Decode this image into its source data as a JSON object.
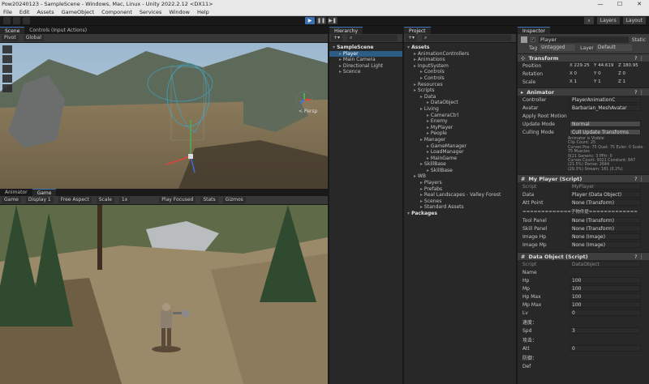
{
  "window": {
    "title": "Pow20240123 - SampleScene - Windows, Mac, Linux - Unity 2022.2.12 <DX11>",
    "minimize": "—",
    "maximize": "☐",
    "close": "✕"
  },
  "menu": [
    "File",
    "Edit",
    "Assets",
    "GameObject",
    "Component",
    "Services",
    "Window",
    "Help"
  ],
  "toolbar": {
    "play": "▶",
    "pause": "❚❚",
    "step": "▶❚",
    "layers": "Layers",
    "layout": "Layout"
  },
  "scene": {
    "tabs": [
      "Scene",
      "Controls (Input Actions)"
    ],
    "pivot": "Pivot",
    "global": "Global",
    "persp": "< Persp"
  },
  "game": {
    "tabs": [
      "Animator",
      "Game"
    ],
    "game_label": "Game",
    "display": "Display 1",
    "aspect": "Free Aspect",
    "scale_label": "Scale",
    "scale_value": "1x",
    "play_focused": "Play Focused",
    "stats": "Stats",
    "gizmos": "Gizmos"
  },
  "hierarchy": {
    "tab": "Hierarchy",
    "items": [
      {
        "label": "SampleScene",
        "depth": 0,
        "style": "bold"
      },
      {
        "label": "Player",
        "depth": 1,
        "style": "sel"
      },
      {
        "label": "Main Camera",
        "depth": 1,
        "style": ""
      },
      {
        "label": "Directional Light",
        "depth": 1,
        "style": ""
      },
      {
        "label": "Scence",
        "depth": 1,
        "style": ""
      }
    ]
  },
  "project": {
    "tab": "Project",
    "items": [
      {
        "label": "Assets",
        "depth": 0,
        "style": "bold"
      },
      {
        "label": "AnimationControllers",
        "depth": 1,
        "style": ""
      },
      {
        "label": "Animations",
        "depth": 1,
        "style": ""
      },
      {
        "label": "InputSystem",
        "depth": 1,
        "style": ""
      },
      {
        "label": "Controls",
        "depth": 2,
        "style": ""
      },
      {
        "label": "Controls",
        "depth": 2,
        "style": ""
      },
      {
        "label": "Resources",
        "depth": 1,
        "style": ""
      },
      {
        "label": "Scripts",
        "depth": 1,
        "style": ""
      },
      {
        "label": "Data",
        "depth": 2,
        "style": ""
      },
      {
        "label": "DataObject",
        "depth": 3,
        "style": ""
      },
      {
        "label": "Living",
        "depth": 2,
        "style": ""
      },
      {
        "label": "CameraCtrl",
        "depth": 3,
        "style": ""
      },
      {
        "label": "Enemy",
        "depth": 3,
        "style": ""
      },
      {
        "label": "MyPlayer",
        "depth": 3,
        "style": ""
      },
      {
        "label": "People",
        "depth": 3,
        "style": ""
      },
      {
        "label": "Manager",
        "depth": 2,
        "style": ""
      },
      {
        "label": "GameManager",
        "depth": 3,
        "style": ""
      },
      {
        "label": "LoadManager",
        "depth": 3,
        "style": ""
      },
      {
        "label": "MainGame",
        "depth": 3,
        "style": ""
      },
      {
        "label": "SkillBase",
        "depth": 2,
        "style": ""
      },
      {
        "label": "SkillBase",
        "depth": 3,
        "style": ""
      },
      {
        "label": "WB",
        "depth": 1,
        "style": ""
      },
      {
        "label": "Players",
        "depth": 2,
        "style": ""
      },
      {
        "label": "Prefabs",
        "depth": 2,
        "style": ""
      },
      {
        "label": "Real Landscapes - Valley Forest",
        "depth": 2,
        "style": ""
      },
      {
        "label": "Scenes",
        "depth": 2,
        "style": ""
      },
      {
        "label": "Standard Assets",
        "depth": 2,
        "style": ""
      },
      {
        "label": "Packages",
        "depth": 0,
        "style": "bold"
      }
    ]
  },
  "inspector": {
    "tab": "Inspector",
    "object_name": "Player",
    "static_label": "Static",
    "tag_label": "Tag",
    "tag_value": "Untagged",
    "layer_label": "Layer",
    "layer_value": "Default",
    "transform": {
      "title": "Transform",
      "position_label": "Position",
      "rotation_label": "Rotation",
      "scale_label": "Scale",
      "position": [
        "X 229.25",
        "Y 44.619",
        "Z 180.95"
      ],
      "rotation": [
        "X 0",
        "Y 0",
        "Z 0"
      ],
      "scale": [
        "X 1",
        "Y 1",
        "Z 1"
      ]
    },
    "animator": {
      "title": "Animator",
      "controller_label": "Controller",
      "controller_value": "PlayerAnimationC",
      "avatar_label": "Avatar",
      "avatar_value": "Barbarian_MeshAvatar",
      "root_motion_label": "Apply Root Motion",
      "update_label": "Update Mode",
      "update_value": "Normal",
      "culling_label": "Culling Mode",
      "culling_value": "Cull Update Transforms",
      "notes": [
        "Animator is Visible",
        "Clip Count: 25",
        "Curves Pos: 75 Quat: 75 Euler: 0 Scale: 75 Muscles",
        "0(21 Generic: 3 PPtr: 0",
        "Curves Count: 9021 Constant: 847 (21.5%) Dense: 2644",
        "(29.3%) Stream: 181 (0.2%)"
      ]
    },
    "myplayer": {
      "title": "My Player (Script)",
      "script_label": "Script",
      "script_value": "MyPlayer",
      "data_label": "Data",
      "data_value": "Player (Data Object)",
      "att_label": "Att Point",
      "att_value": "None (Transform)",
      "divider": "=============子物件提=============",
      "tool_label": "Tool Panel",
      "tool_value": "None (Transform)",
      "skill_label": "Skill Panel",
      "skill_value": "None (Transform)",
      "hp_img_label": "Image Hp",
      "hp_img_value": "None (Image)",
      "mp_img_label": "Image Mp",
      "mp_img_value": "None (Image)"
    },
    "dataobject": {
      "title": "Data Object (Script)",
      "script_label": "Script",
      "script_value": "DataObject",
      "name_label": "Name",
      "hp_label": "Hp",
      "hp": "100",
      "mp_label": "Mp",
      "mp": "100",
      "hpmax_label": "Hp Max",
      "hpmax": "100",
      "mpmax_label": "Mp Max",
      "mpmax": "100",
      "lv_label": "Lv",
      "lv": "0",
      "speed_header": "速度：",
      "spd_label": "Spd",
      "spd": "3",
      "attack_header": "攻击：",
      "att_label": "Att",
      "att": "0",
      "defense_header": "防御：",
      "def_label": "Def"
    }
  }
}
